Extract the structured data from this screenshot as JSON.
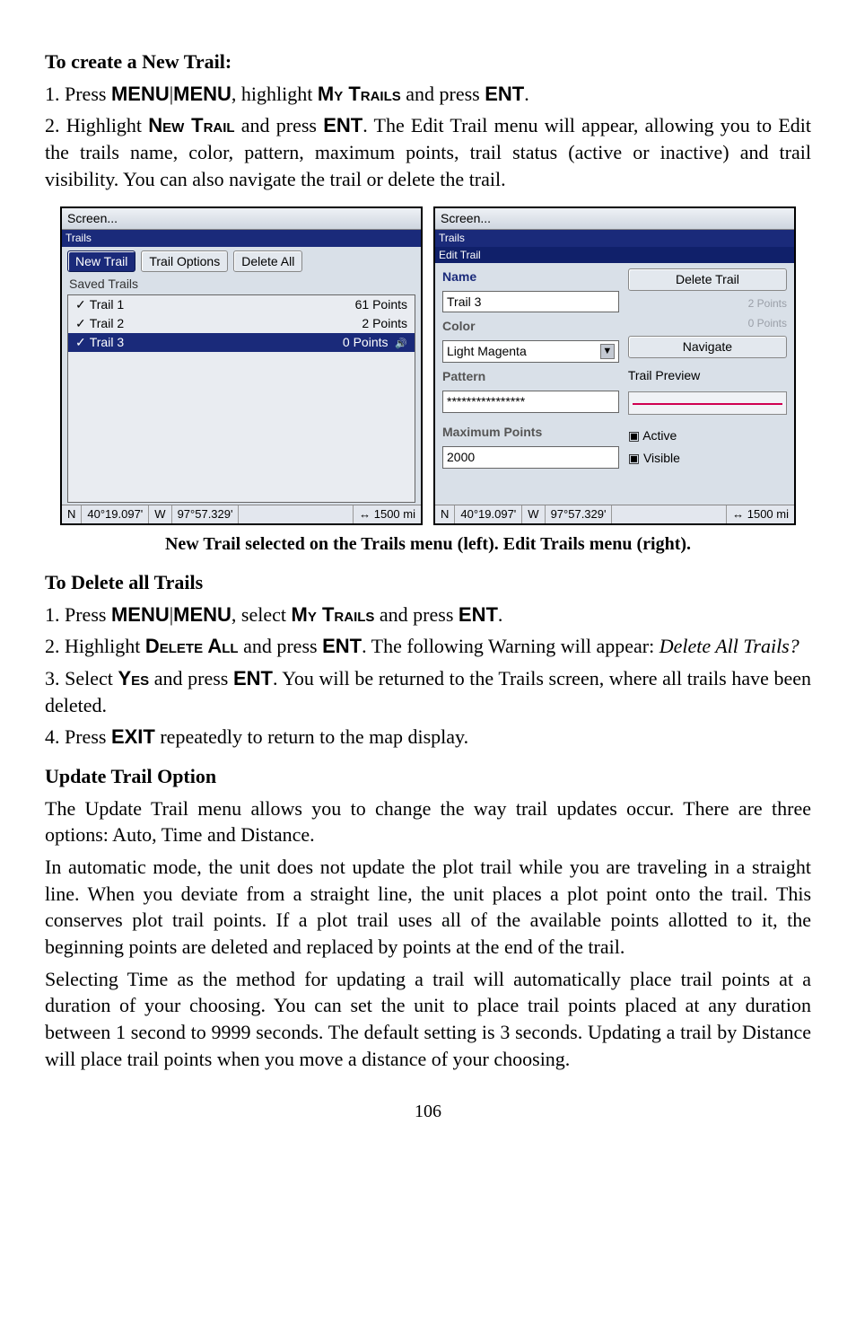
{
  "section1": {
    "heading": "To create a New Trail:",
    "step1_pre": "1. Press ",
    "step1_menu": "MENU",
    "step1_pipe": "|",
    "step1_menu2": "MENU",
    "step1_mid": ", highlight ",
    "step1_mytrails": "My Trails",
    "step1_mid2": " and press ",
    "step1_ent": "ENT",
    "step1_end": ".",
    "step2_pre": "2. Highlight ",
    "step2_newtrail": "New Trail",
    "step2_mid": " and press ",
    "step2_ent": "ENT",
    "step2_rest": ". The Edit Trail menu will appear, allowing you to Edit the trails name, color, pattern, maximum points, trail status (active or inactive) and trail visibility. You can also navigate the trail or delete the trail."
  },
  "left": {
    "titlebar": "Screen...",
    "blue": "Trails",
    "btn_new": "New Trail",
    "btn_opts": "Trail Options",
    "btn_del": "Delete All",
    "saved": "Saved Trails",
    "rows": [
      {
        "name": "Trail 1",
        "pts": "61 Points"
      },
      {
        "name": "Trail 2",
        "pts": "2 Points"
      },
      {
        "name": "Trail 3",
        "pts": "0 Points"
      }
    ],
    "status_n": "N",
    "status_lat": "40°19.097'",
    "status_w": "W",
    "status_lon": "97°57.329'",
    "status_scale": "↔ 1500 mi"
  },
  "right": {
    "titlebar": "Screen...",
    "blue": "Trails",
    "blue2": "Edit Trail",
    "name_lbl": "Name",
    "name_val": "Trail 3",
    "color_lbl": "Color",
    "color_val": "Light Magenta",
    "pattern_lbl": "Pattern",
    "pattern_val": "****************",
    "max_lbl": "Maximum Points",
    "max_val": "2000",
    "btn_delete": "Delete Trail",
    "gray1": "2 Points",
    "gray2": "0 Points",
    "btn_nav": "Navigate",
    "preview_lbl": "Trail Preview",
    "chk_active": "Active",
    "chk_visible": "Visible",
    "status_n": "N",
    "status_lat": "40°19.097'",
    "status_w": "W",
    "status_lon": "97°57.329'",
    "status_scale": "↔ 1500 mi"
  },
  "caption": "New Trail selected on the Trails menu (left). Edit Trails menu (right).",
  "section2": {
    "heading": "To Delete all Trails",
    "s1_pre": "1. Press ",
    "s1_menu": "MENU",
    "s1_pipe": "|",
    "s1_menu2": "MENU",
    "s1_mid": ", select ",
    "s1_mt": "My Trails",
    "s1_mid2": " and press ",
    "s1_ent": "ENT",
    "s1_end": ".",
    "s2_pre": "2. Highlight ",
    "s2_da": "Delete All",
    "s2_mid": " and press ",
    "s2_ent": "ENT",
    "s2_rest": ". The following Warning will appear: ",
    "s2_it": "Delete All Trails?",
    "s3_pre": "3. Select ",
    "s3_yes": "Yes",
    "s3_mid": " and press ",
    "s3_ent": "ENT",
    "s3_rest": ". You will be returned to the Trails screen, where all trails have been deleted.",
    "s4_pre": "4. Press ",
    "s4_exit": "EXIT",
    "s4_rest": " repeatedly to return to the map display."
  },
  "section3": {
    "heading": "Update Trail Option",
    "p1": "The Update Trail menu allows you to change the way trail updates occur. There are three options: Auto, Time and Distance.",
    "p2": "In automatic mode, the unit does not update the plot trail while you are traveling in a straight line. When you deviate from a straight line, the unit places a plot point onto the trail. This conserves plot trail points. If a plot trail uses all of the available points allotted to it, the beginning points are deleted and replaced by points at the end of the trail.",
    "p3": "Selecting Time as the method for updating a trail will automatically place trail points at a duration of your choosing. You can set the unit to place trail points placed at any duration between 1 second to 9999 seconds. The default setting is 3 seconds. Updating a trail by Distance will place trail points when you move a distance of your choosing."
  },
  "pagenum": "106"
}
